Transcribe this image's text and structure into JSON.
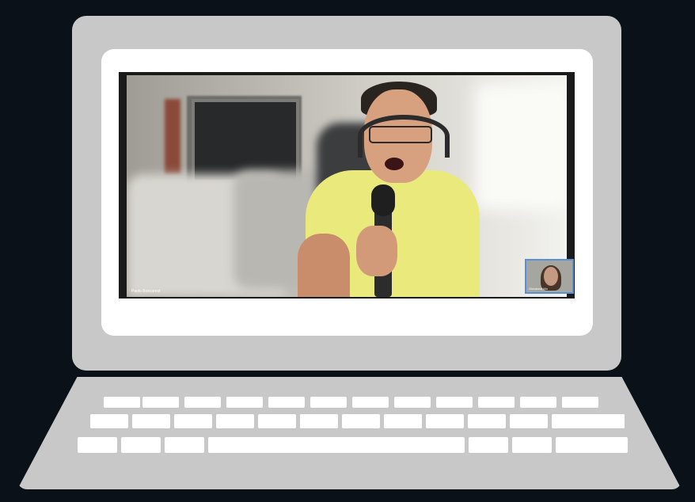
{
  "call": {
    "main_participant_name": "Paolo Boscarest",
    "thumbnail_participant_name": "Giovanna Mo"
  },
  "colors": {
    "background": "#0b1119",
    "laptop_body": "#c8c8c8",
    "bezel": "#ffffff",
    "thumbnail_border": "#5a8fd6"
  },
  "icons": {
    "laptop": "laptop-icon"
  }
}
